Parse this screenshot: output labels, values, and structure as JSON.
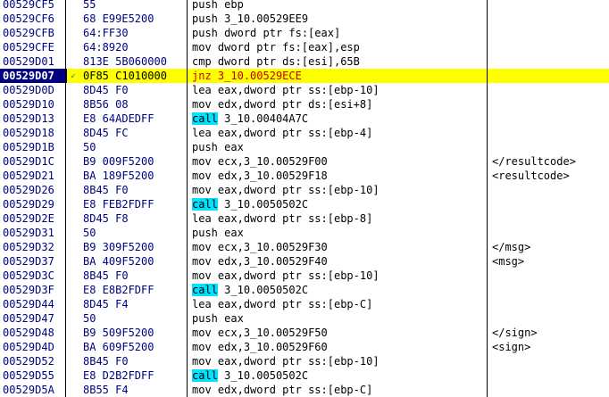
{
  "rows": [
    {
      "addr": "00529CF5",
      "hex": "55",
      "mnemonic": "push",
      "operands": "ebp",
      "comment": ""
    },
    {
      "addr": "00529CF6",
      "hex": "68 E99E5200",
      "mnemonic": "push",
      "operands": "3_10.00529EE9",
      "comment": ""
    },
    {
      "addr": "00529CFB",
      "hex": "64:FF30",
      "mnemonic": "push",
      "operands": "dword ptr fs:[eax]",
      "comment": ""
    },
    {
      "addr": "00529CFE",
      "hex": "64:8920",
      "mnemonic": "mov",
      "operands": "dword ptr fs:[eax],esp",
      "comment": ""
    },
    {
      "addr": "00529D01",
      "hex": "813E 5B060000",
      "mnemonic": "cmp",
      "operands": "dword ptr ds:[esi],65B",
      "comment": ""
    },
    {
      "addr": "00529D07",
      "hex": "0F85 C1010000",
      "mnemonic": "jnz",
      "operands": "3_10.00529ECE",
      "comment": "",
      "selected": true,
      "jump_marker": "↙"
    },
    {
      "addr": "00529D0D",
      "hex": "8D45 F0",
      "mnemonic": "lea",
      "operands": "eax,dword ptr ss:[ebp-10]",
      "comment": ""
    },
    {
      "addr": "00529D10",
      "hex": "8B56 08",
      "mnemonic": "mov",
      "operands": "edx,dword ptr ds:[esi+8]",
      "comment": ""
    },
    {
      "addr": "00529D13",
      "hex": "E8 64ADEDFF",
      "mnemonic": "call",
      "operands": "3_10.00404A7C",
      "comment": ""
    },
    {
      "addr": "00529D18",
      "hex": "8D45 FC",
      "mnemonic": "lea",
      "operands": "eax,dword ptr ss:[ebp-4]",
      "comment": ""
    },
    {
      "addr": "00529D1B",
      "hex": "50",
      "mnemonic": "push",
      "operands": "eax",
      "comment": ""
    },
    {
      "addr": "00529D1C",
      "hex": "B9 009F5200",
      "mnemonic": "mov",
      "operands": "ecx,3_10.00529F00",
      "comment": "</resultcode>"
    },
    {
      "addr": "00529D21",
      "hex": "BA 189F5200",
      "mnemonic": "mov",
      "operands": "edx,3_10.00529F18",
      "comment": "<resultcode>"
    },
    {
      "addr": "00529D26",
      "hex": "8B45 F0",
      "mnemonic": "mov",
      "operands": "eax,dword ptr ss:[ebp-10]",
      "comment": ""
    },
    {
      "addr": "00529D29",
      "hex": "E8 FEB2FDFF",
      "mnemonic": "call",
      "operands": "3_10.0050502C",
      "comment": ""
    },
    {
      "addr": "00529D2E",
      "hex": "8D45 F8",
      "mnemonic": "lea",
      "operands": "eax,dword ptr ss:[ebp-8]",
      "comment": ""
    },
    {
      "addr": "00529D31",
      "hex": "50",
      "mnemonic": "push",
      "operands": "eax",
      "comment": ""
    },
    {
      "addr": "00529D32",
      "hex": "B9 309F5200",
      "mnemonic": "mov",
      "operands": "ecx,3_10.00529F30",
      "comment": "</msg>"
    },
    {
      "addr": "00529D37",
      "hex": "BA 409F5200",
      "mnemonic": "mov",
      "operands": "edx,3_10.00529F40",
      "comment": "<msg>"
    },
    {
      "addr": "00529D3C",
      "hex": "8B45 F0",
      "mnemonic": "mov",
      "operands": "eax,dword ptr ss:[ebp-10]",
      "comment": ""
    },
    {
      "addr": "00529D3F",
      "hex": "E8 E8B2FDFF",
      "mnemonic": "call",
      "operands": "3_10.0050502C",
      "comment": ""
    },
    {
      "addr": "00529D44",
      "hex": "8D45 F4",
      "mnemonic": "lea",
      "operands": "eax,dword ptr ss:[ebp-C]",
      "comment": ""
    },
    {
      "addr": "00529D47",
      "hex": "50",
      "mnemonic": "push",
      "operands": "eax",
      "comment": ""
    },
    {
      "addr": "00529D48",
      "hex": "B9 509F5200",
      "mnemonic": "mov",
      "operands": "ecx,3_10.00529F50",
      "comment": "</sign>"
    },
    {
      "addr": "00529D4D",
      "hex": "BA 609F5200",
      "mnemonic": "mov",
      "operands": "edx,3_10.00529F60",
      "comment": "<sign>"
    },
    {
      "addr": "00529D52",
      "hex": "8B45 F0",
      "mnemonic": "mov",
      "operands": "eax,dword ptr ss:[ebp-10]",
      "comment": ""
    },
    {
      "addr": "00529D55",
      "hex": "E8 D2B2FDFF",
      "mnemonic": "call",
      "operands": "3_10.0050502C",
      "comment": ""
    },
    {
      "addr": "00529D5A",
      "hex": "8B55 F4",
      "mnemonic": "mov",
      "operands": "edx,dword ptr ss:[ebp-C]",
      "comment": ""
    }
  ],
  "colors": {
    "selected_row_bg": "#ffff00",
    "selected_addr_bg": "#000080",
    "call_highlight": "#00e0ff",
    "jump_text": "#d00000",
    "address_text": "#000080"
  }
}
